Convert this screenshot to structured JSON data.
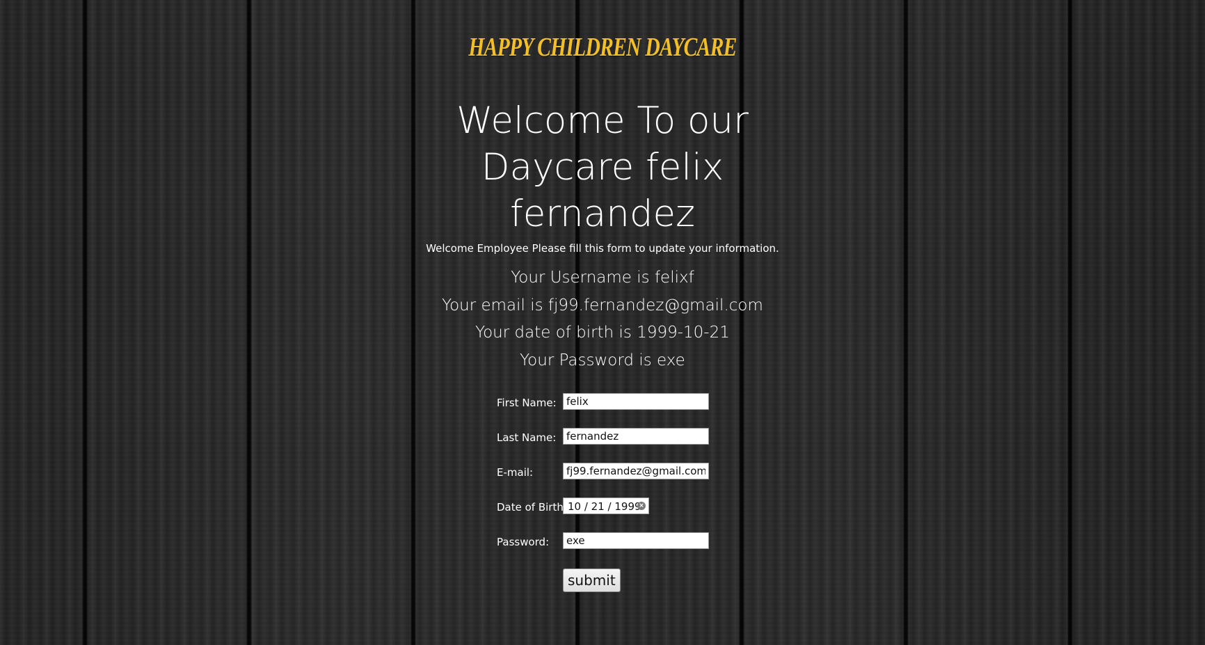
{
  "brand": {
    "title": "HAPPY CHILDREN DAYCARE"
  },
  "header": {
    "welcome": "Welcome To our Daycare felix fernandez",
    "subtitle": "Welcome Employee Please fill this form to update your information."
  },
  "info": {
    "username": "Your Username is felixf",
    "email": "Your email is fj99.fernandez@gmail.com",
    "dob": "Your date of birth is 1999-10-21",
    "password": "Your Password is exe"
  },
  "form": {
    "first_name_label": "First Name:",
    "first_name_value": "felix",
    "last_name_label": "Last Name:",
    "last_name_value": "fernandez",
    "email_label": "E-mail:",
    "email_value": "fj99.fernandez@gmail.com",
    "dob_label": "Date of Birth:",
    "dob_value": "10 / 21 / 1999",
    "password_label": "Password:",
    "password_value": "exe",
    "submit_label": "submit"
  },
  "colors": {
    "brand": "#f2bf2a",
    "text": "#ffffff",
    "background": "#2a2a2a"
  },
  "icons": {
    "date_clear": "clear-circle-icon"
  }
}
